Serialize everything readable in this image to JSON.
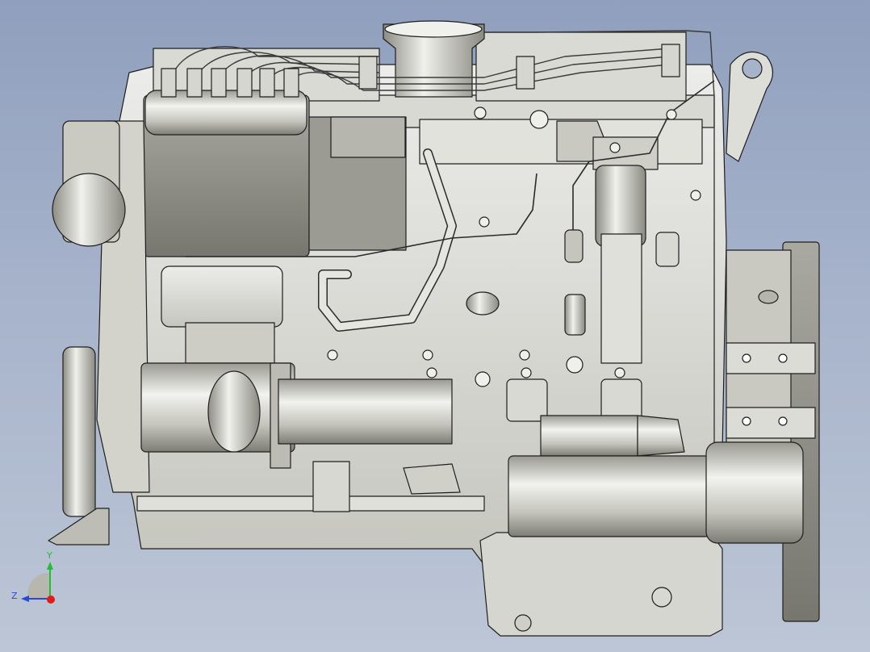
{
  "viewport": {
    "background_top": "#8f9fbd",
    "background_bottom": "#bcc6d6"
  },
  "model": {
    "metal_light": "#e6e6e1",
    "metal_mid": "#c9c9c2",
    "metal_dark": "#8b8b84",
    "edge": "#1e1e1e"
  },
  "triad": {
    "y_label": "Y",
    "z_label": "Z",
    "y_color": "#1fbf2e",
    "z_color": "#2a49d8",
    "x_color": "#e31b1b"
  }
}
